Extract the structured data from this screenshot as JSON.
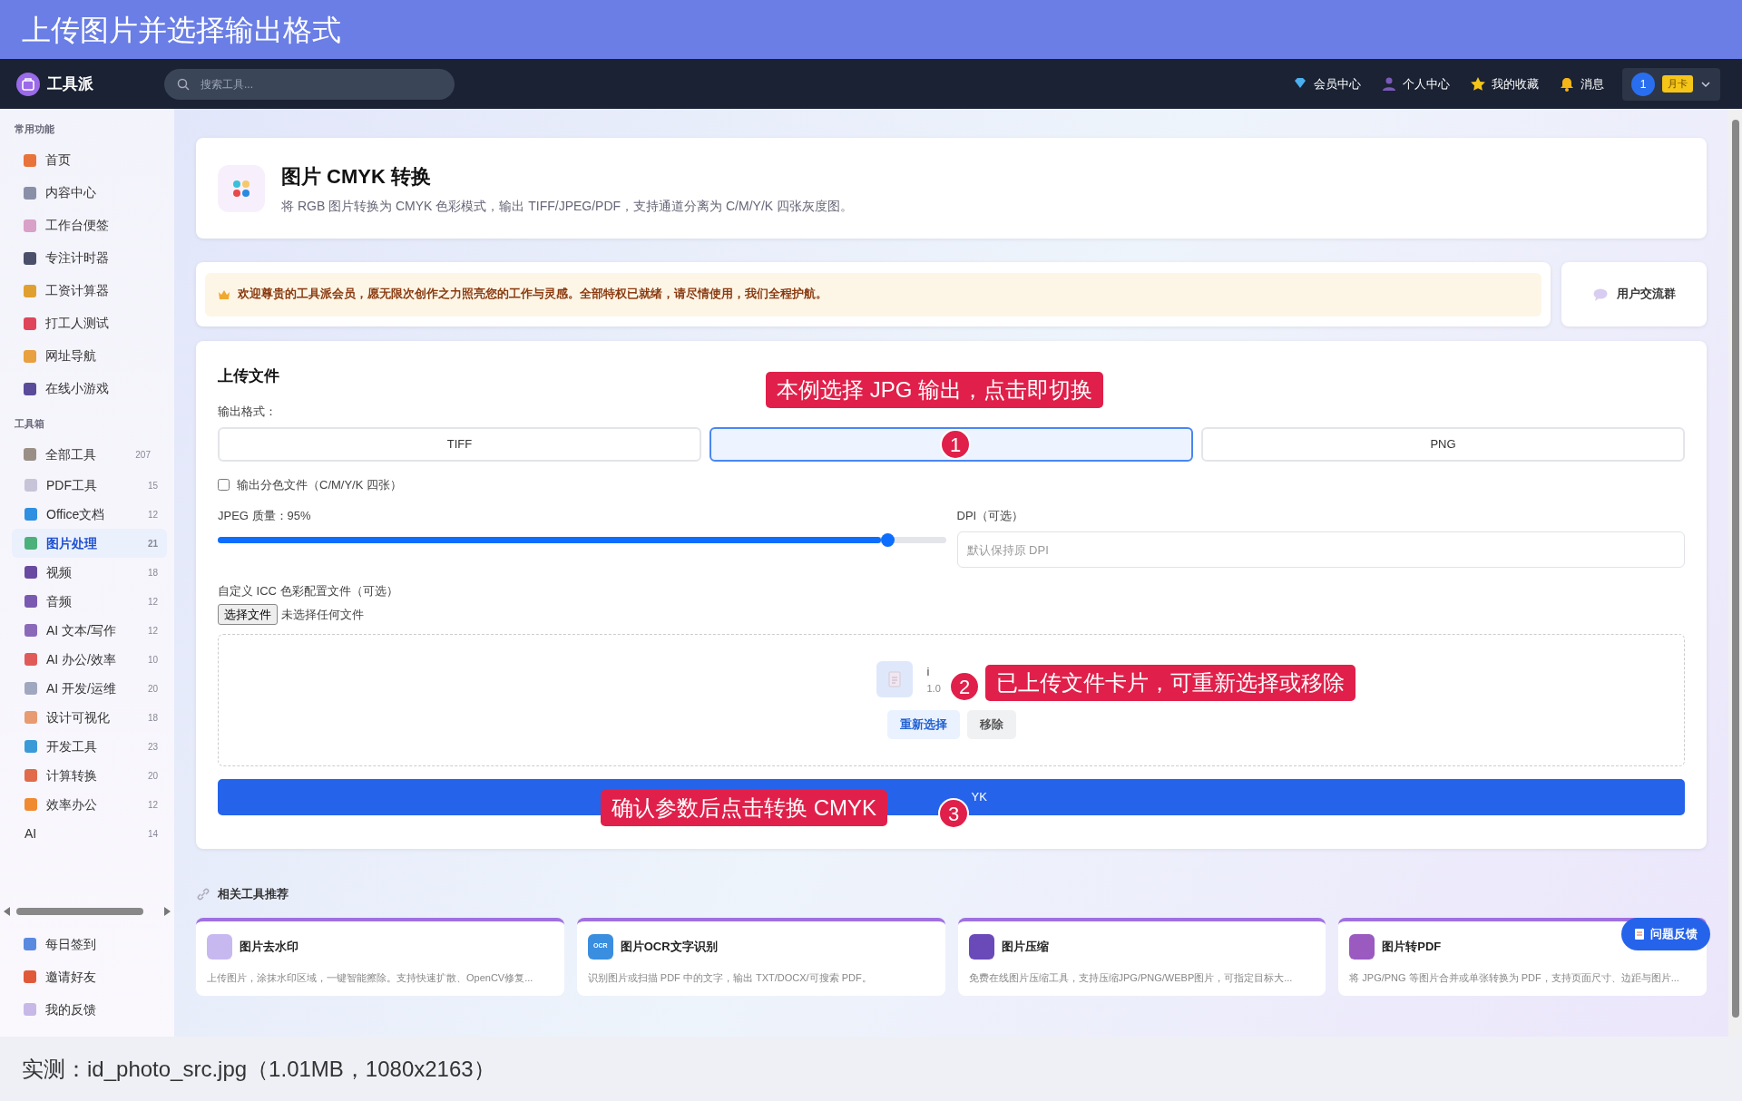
{
  "caption_title": "上传图片并选择输出格式",
  "navbar": {
    "brand": "工具派",
    "search_placeholder": "搜索工具...",
    "links": [
      "会员中心",
      "个人中心",
      "我的收藏",
      "消息"
    ],
    "user_badge": "1",
    "plan": "月卡"
  },
  "sidebar": {
    "sections": [
      {
        "title": "常用功能",
        "items": [
          {
            "label": "首页",
            "color": "#e8743b"
          },
          {
            "label": "内容中心",
            "color": "#8a8fa8"
          },
          {
            "label": "工作台便签",
            "color": "#d9a0c8"
          },
          {
            "label": "专注计时器",
            "color": "#4a4f6a"
          },
          {
            "label": "工资计算器",
            "color": "#e0a030"
          },
          {
            "label": "打工人测试",
            "color": "#e0445a"
          },
          {
            "label": "网址导航",
            "color": "#e8a040"
          },
          {
            "label": "在线小游戏",
            "color": "#5a4a9a"
          }
        ]
      },
      {
        "title": "工具箱",
        "items": [
          {
            "label": "全部工具",
            "count": "207",
            "color": "#9a8f86",
            "children": [
              {
                "label": "PDF工具",
                "count": "15",
                "selected": false,
                "color": "#c8c4d8"
              },
              {
                "label": "Office文档",
                "count": "12",
                "selected": false,
                "color": "#2f8fe0"
              },
              {
                "label": "图片处理",
                "count": "21",
                "selected": true,
                "color": "#4bb07a"
              },
              {
                "label": "视频",
                "count": "18",
                "selected": false,
                "color": "#6a4aa0"
              },
              {
                "label": "音频",
                "count": "12",
                "selected": false,
                "color": "#7a5ab0"
              },
              {
                "label": "AI 文本/写作",
                "count": "12",
                "selected": false,
                "color": "#8a6ab8"
              },
              {
                "label": "AI 办公/效率",
                "count": "10",
                "selected": false,
                "color": "#e05a5a"
              },
              {
                "label": "AI 开发/运维",
                "count": "20",
                "selected": false,
                "color": "#a0a8c0"
              },
              {
                "label": "设计可视化",
                "count": "18",
                "selected": false,
                "color": "#e89a70"
              },
              {
                "label": "开发工具",
                "count": "23",
                "selected": false,
                "color": "#3a9ad8"
              },
              {
                "label": "计算转换",
                "count": "20",
                "selected": false,
                "color": "#e06a4a"
              },
              {
                "label": "效率办公",
                "count": "12",
                "selected": false,
                "color": "#f08a30"
              },
              {
                "label": "AI",
                "count": "14",
                "selected": false
              }
            ]
          }
        ]
      }
    ],
    "footer_items": [
      {
        "label": "每日签到",
        "color": "#5a8ae0"
      },
      {
        "label": "邀请好友",
        "color": "#e05a3a"
      },
      {
        "label": "我的反馈",
        "color": "#c8b8e8"
      }
    ]
  },
  "tool": {
    "title": "图片 CMYK 转换",
    "description": "将 RGB 图片转换为 CMYK 色彩模式，输出 TIFF/JPEG/PDF，支持通道分离为 C/M/Y/K 四张灰度图。"
  },
  "notice": "欢迎尊贵的工具派会员，愿无限次创作之力照亮您的工作与灵感。全部特权已就绪，请尽情使用，我们全程护航。",
  "community_button": "用户交流群",
  "upload": {
    "heading": "上传文件",
    "format_label": "输出格式：",
    "formats": [
      {
        "label": "TIFF",
        "selected": false
      },
      {
        "selected": true
      },
      {
        "label": "PNG",
        "selected": false
      }
    ],
    "separate_channels": {
      "label": "输出分色文件（C/M/Y/K 四张）",
      "checked": false
    },
    "quality": {
      "label": "JPEG 质量：95%",
      "level": 0.92
    },
    "dpi": {
      "label": "DPI（可选）",
      "placeholder": "默认保持原 DPI"
    },
    "icc": {
      "label": "自定义 ICC 色彩配置文件（可选）",
      "button": "选择文件",
      "status": "未选择任何文件"
    },
    "file_card": {
      "name": "i",
      "size": "1.0"
    },
    "file_actions": [
      "重新选择",
      "移除"
    ],
    "convert_button": "YK"
  },
  "related": {
    "title": "相关工具推荐",
    "cards": [
      {
        "title": "图片去水印",
        "description": "上传图片，涂抹水印区域，一键智能擦除。支持快速扩散、OpenCV修复...",
        "color": "#c8b8f0"
      },
      {
        "title": "图片OCR文字识别",
        "description": "识别图片或扫描 PDF 中的文字，输出 TXT/DOCX/可搜索 PDF。",
        "color": "#3a8ee0",
        "icon_text": "OCR"
      },
      {
        "title": "图片压缩",
        "description": "免费在线图片压缩工具，支持压缩JPG/PNG/WEBP图片，可指定目标大...",
        "color": "#6a4ab8"
      },
      {
        "title": "图片转PDF",
        "description": "将 JPG/PNG 等图片合并或单张转换为 PDF，支持页面尺寸、边距与图片...",
        "color": "#9a5ac0"
      }
    ]
  },
  "feedback_button": "问题反馈",
  "callouts": [
    {
      "number": "1",
      "text": "本例选择 JPG 输出，点击即切换"
    },
    {
      "number": "2",
      "text": "已上传文件卡片，可重新选择或移除"
    },
    {
      "number": "3",
      "text": "确认参数后点击转换 CMYK"
    }
  ],
  "footer_caption": "实测：id_photo_src.jpg（1.01MB，1080x2163）"
}
